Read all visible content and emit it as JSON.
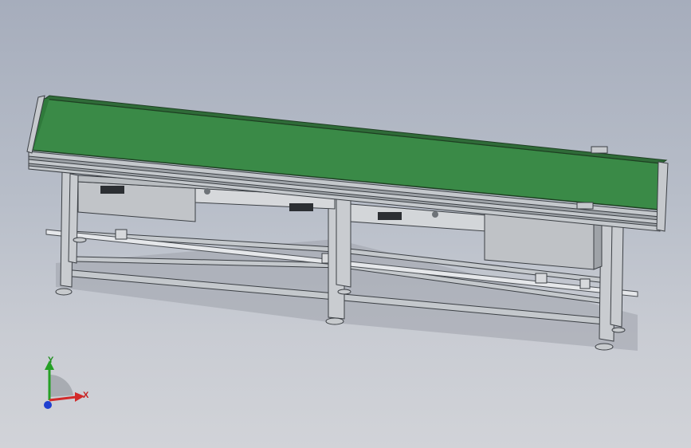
{
  "viewport": {
    "background_top": "#a6adbc",
    "background_bottom": "#d1d3d8"
  },
  "model": {
    "belt_color": "#3a8a47",
    "frame_color": "#c4c8cc",
    "frame_edge_color": "#3b3f44",
    "box_color": "#bfc2c6"
  },
  "triad": {
    "x_label": "X",
    "y_label": "Y",
    "x_color": "#d22a2a",
    "y_color": "#25a025",
    "z_color": "#1f3fd0"
  }
}
